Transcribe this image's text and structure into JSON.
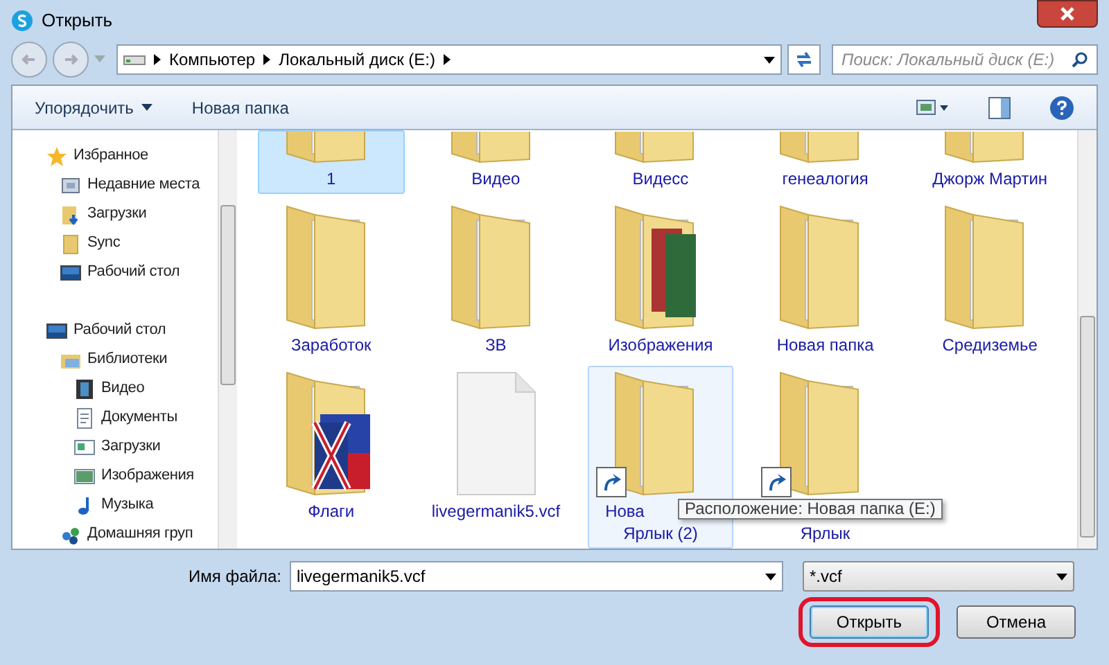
{
  "window": {
    "title": "Открыть"
  },
  "address": {
    "crumbs": [
      "Компьютер",
      "Локальный диск (E:)"
    ]
  },
  "search": {
    "placeholder": "Поиск: Локальный диск (E:)"
  },
  "toolbar": {
    "organize": "Упорядочить",
    "new_folder": "Новая папка"
  },
  "sidebar": [
    {
      "label": "Избранное",
      "kind": "star",
      "children": [
        {
          "label": "Недавние места",
          "kind": "recent"
        },
        {
          "label": "Загрузки",
          "kind": "download-folder"
        },
        {
          "label": "Sync",
          "kind": "folder"
        },
        {
          "label": "Рабочий стол",
          "kind": "desktop"
        }
      ]
    },
    {
      "label": "Рабочий стол",
      "kind": "desktop",
      "children": [
        {
          "label": "Библиотеки",
          "kind": "library",
          "children": [
            {
              "label": "Видео",
              "kind": "video"
            },
            {
              "label": "Документы",
              "kind": "document"
            },
            {
              "label": "Загрузки",
              "kind": "downloads"
            },
            {
              "label": "Изображения",
              "kind": "pictures"
            },
            {
              "label": "Музыка",
              "kind": "music"
            }
          ]
        },
        {
          "label": "Домашняя груп",
          "kind": "homegroup"
        }
      ]
    }
  ],
  "items": [
    {
      "lines": [
        "1"
      ],
      "kind": "cut",
      "selected": true,
      "hovered": false
    },
    {
      "lines": [
        "Видео"
      ],
      "kind": "cut",
      "selected": false,
      "hovered": false
    },
    {
      "lines": [
        "Видесс"
      ],
      "kind": "cut",
      "selected": false,
      "hovered": false
    },
    {
      "lines": [
        "генеалогия"
      ],
      "kind": "cut",
      "selected": false,
      "hovered": false
    },
    {
      "lines": [
        "Джорж Мартин"
      ],
      "kind": "cut",
      "selected": false,
      "hovered": false
    },
    {
      "lines": [
        "Заработок"
      ],
      "kind": "folder",
      "selected": false,
      "hovered": false
    },
    {
      "lines": [
        "ЗВ"
      ],
      "kind": "folder",
      "selected": false,
      "hovered": false
    },
    {
      "lines": [
        "Изображения"
      ],
      "kind": "pictures",
      "selected": false,
      "hovered": false
    },
    {
      "lines": [
        "Новая папка"
      ],
      "kind": "folder",
      "selected": false,
      "hovered": false
    },
    {
      "lines": [
        "Средиземье"
      ],
      "kind": "folder",
      "selected": false,
      "hovered": false
    },
    {
      "lines": [
        "Флаги"
      ],
      "kind": "flag",
      "selected": false,
      "hovered": false
    },
    {
      "lines": [
        "livegermanik5.vcf"
      ],
      "kind": "file",
      "selected": false,
      "hovered": false
    },
    {
      "lines": [
        "Нова",
        "Ярлык (2)"
      ],
      "kind": "shortcut",
      "selected": false,
      "hovered": true
    },
    {
      "lines": [
        "Ярлык"
      ],
      "kind": "shortcut",
      "selected": false,
      "hovered": false
    }
  ],
  "tooltip": "Расположение: Новая папка (E:)",
  "filename": {
    "label": "Имя файла:",
    "value": "livegermanik5.vcf"
  },
  "filter": {
    "value": "*.vcf"
  },
  "buttons": [
    {
      "label": "Открыть",
      "highlighted": true
    },
    {
      "label": "Отмена",
      "highlighted": false
    }
  ]
}
